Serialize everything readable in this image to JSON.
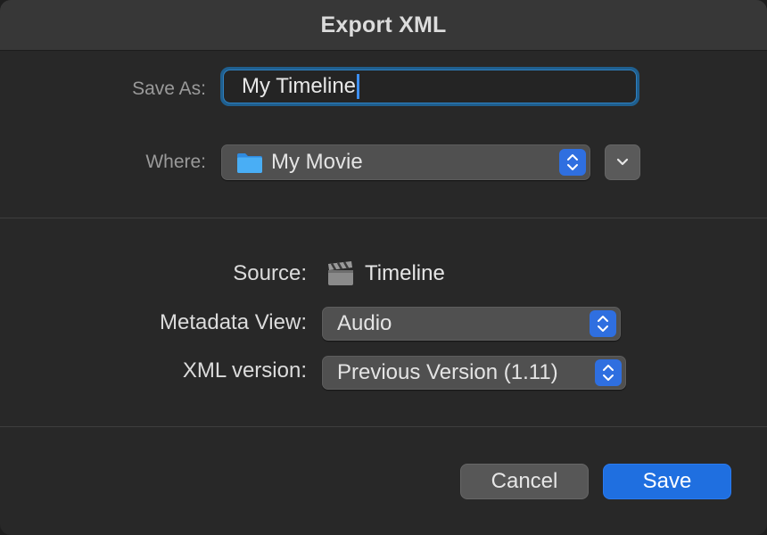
{
  "window": {
    "title": "Export XML"
  },
  "save_as": {
    "label": "Save As:",
    "value": "My Timeline"
  },
  "where": {
    "label": "Where:",
    "value": "My Movie",
    "icon": "folder-icon"
  },
  "source": {
    "label": "Source:",
    "value": "Timeline",
    "icon": "clapperboard-icon"
  },
  "metadata_view": {
    "label": "Metadata View:",
    "value": "Audio"
  },
  "xml_version": {
    "label": "XML version:",
    "value": "Previous Version (1.11)"
  },
  "buttons": {
    "cancel": "Cancel",
    "save": "Save"
  },
  "colors": {
    "accent": "#1f6fe0",
    "focus_ring": "#1f5f8f",
    "folder": "#3aa0ee"
  }
}
